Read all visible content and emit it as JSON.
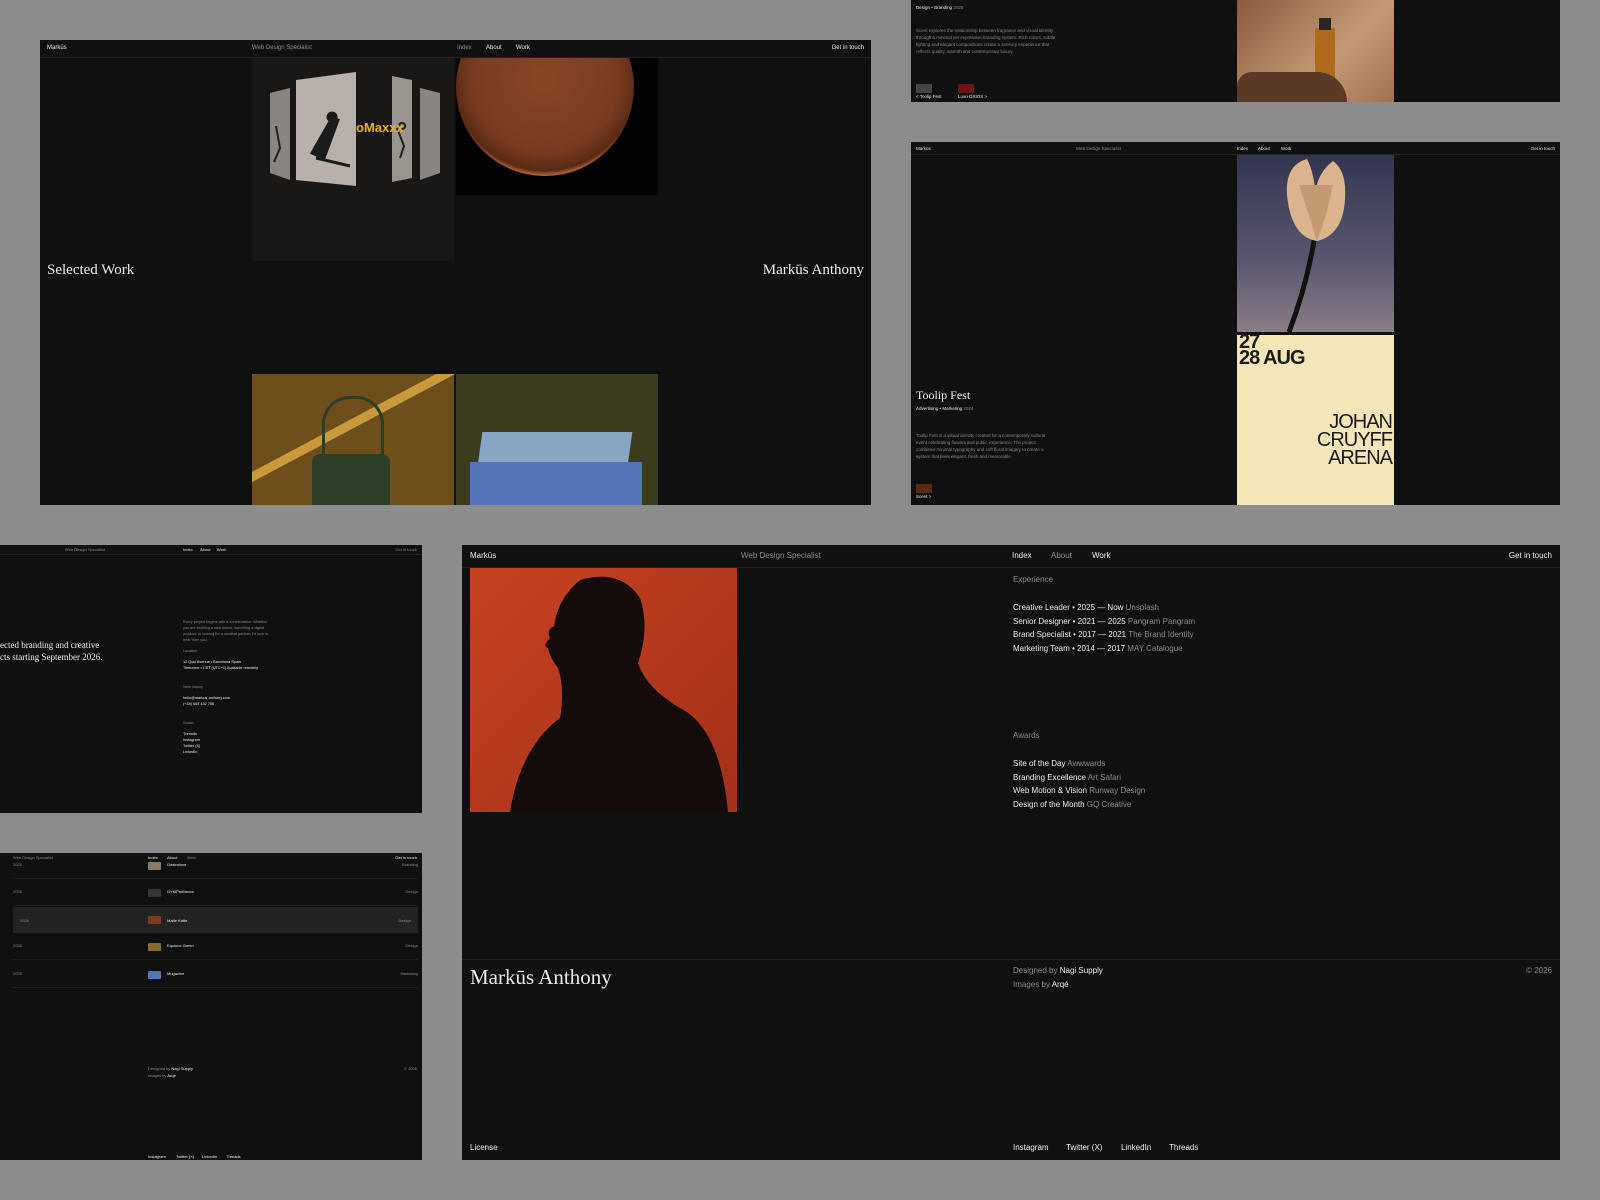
{
  "nav": {
    "brand": "Markūs",
    "tagline": "Web Design Specialist",
    "index": "Index",
    "about": "About",
    "work": "Work",
    "cta": "Get in touch"
  },
  "selected_work": {
    "heading": "Selected Work",
    "name": "Markūs Anthony",
    "brand_word": "oMaxxx"
  },
  "scent": {
    "meta_category": "Design • Branding",
    "meta_year": "2025",
    "description": "Scent explores the relationship between fragrance and visual identity through a minimal yet expressive branding system. Rich colors, subtle lighting and elegant compositions create a sensory experience that reflects quality, warmth and contemporary luxury.",
    "prev_label": "< Toolip Fest",
    "next_label": "Luxo OXIOS >"
  },
  "toolip": {
    "title": "Toolip Fest",
    "meta_category": "Advertising • Marketing",
    "meta_year": "2024",
    "description": "Toolip Fest is a visual identity created for a contemporary cultural event celebrating flowers and public experience. The project combines minimal typography and soft floral imagery to create a system that feels elegant, fresh and memorable.",
    "next_label": "Scent >",
    "poster_dates": [
      "27",
      "28 AUG"
    ],
    "poster_venue": [
      "JOHAN",
      "CRUYFF",
      "ARENA"
    ]
  },
  "contact": {
    "intro_line1": "ected branding and creative",
    "intro_line2": "cts starting September 2026.",
    "body": "Every project begins with a conversation. Whether you are building a new brand, launching a digital product, or looking for a creative partner, I'd love to hear from you.",
    "location_label": "Location",
    "location_line1": "12 Quiz Avenue • Barcelona Spain",
    "location_line2": "Timezone • CET (UTC+1) Available remotely",
    "inquiry_label": "New Inquiry",
    "email": "hello@markus-anthony.com",
    "phone": "(+34) 654 432 756",
    "social_label": "Social",
    "socials": [
      "Threads",
      "Instagram",
      "Twitter (X)",
      "LinkedIn"
    ]
  },
  "index_list": {
    "rows": [
      {
        "year": "2025",
        "name": "Gastrolove",
        "category": "Branding"
      },
      {
        "year": "2026",
        "name": "GYMProMaxxx",
        "category": "Design"
      },
      {
        "year": "2026",
        "name": "Matte Kaffe",
        "category": "Design"
      },
      {
        "year": "2026",
        "name": "Equinox Green",
        "category": "Design"
      },
      {
        "year": "2025",
        "name": "Mugazine",
        "category": "Marketing"
      }
    ],
    "designed_label": "Designed by",
    "designed_by": "Nagi Supply",
    "images_label": "Images by",
    "images_by": "Arqé",
    "copyright": "© 2026",
    "footer_links": [
      "Instagram",
      "Twitter (X)",
      "LinkedIn",
      "Threads"
    ]
  },
  "about": {
    "experience_label": "Experience",
    "experience": [
      {
        "role": "Creative Leader",
        "years": "2025 — Now",
        "company": "Unsplash"
      },
      {
        "role": "Senior Designer",
        "years": "2021 — 2025",
        "company": "Pangram Pangram"
      },
      {
        "role": "Brand Specialist",
        "years": "2017 — 2021",
        "company": "The Brand Identity"
      },
      {
        "role": "Marketing Team",
        "years": "2014 — 2017",
        "company": "MAY Catalogue"
      }
    ],
    "awards_label": "Awards",
    "awards": [
      {
        "title": "Site of the Day",
        "org": "Awwwards"
      },
      {
        "title": "Branding Excellence",
        "org": "Art Safari"
      },
      {
        "title": "Web Motion & Vision",
        "org": "Runway Design"
      },
      {
        "title": "Design of the Month",
        "org": "GQ Creative"
      }
    ],
    "footer_name": "Markūs Anthony",
    "designed_label": "Designed by",
    "designed_by": "Nagi Supply",
    "images_label": "Images by",
    "images_by": "Arqé",
    "copyright": "© 2026",
    "license": "License",
    "links": [
      "Instagram",
      "Twitter (X)",
      "LinkedIn",
      "Threads"
    ]
  },
  "colors": {
    "bg": "#8c8c8c",
    "panel": "#101010",
    "accent_orange": "#c7421f",
    "poster_yellow": "#f4e6b6",
    "brand_yellow": "#e6b400"
  }
}
